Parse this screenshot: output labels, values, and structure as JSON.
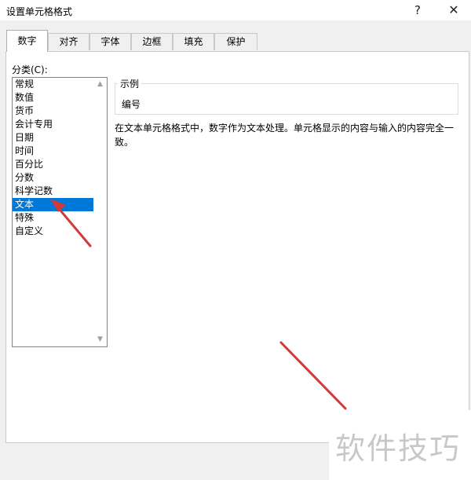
{
  "window": {
    "title": "设置单元格格式",
    "help": "?",
    "close": "✕"
  },
  "tabs": [
    {
      "label": "数字",
      "active": true
    },
    {
      "label": "对齐"
    },
    {
      "label": "字体"
    },
    {
      "label": "边框"
    },
    {
      "label": "填充"
    },
    {
      "label": "保护"
    }
  ],
  "category": {
    "label": "分类(C):",
    "items": [
      "常规",
      "数值",
      "货币",
      "会计专用",
      "日期",
      "时间",
      "百分比",
      "分数",
      "科学记数",
      "文本",
      "特殊",
      "自定义"
    ],
    "selected": "文本"
  },
  "sample": {
    "legend": "示例",
    "value": "编号"
  },
  "description": "在文本单元格格式中，数字作为文本处理。单元格显示的内容与输入的内容完全一致。",
  "watermark": "软件技巧",
  "colors": {
    "selection": "#0078d7",
    "annotation_arrow": "#d23a3a"
  }
}
